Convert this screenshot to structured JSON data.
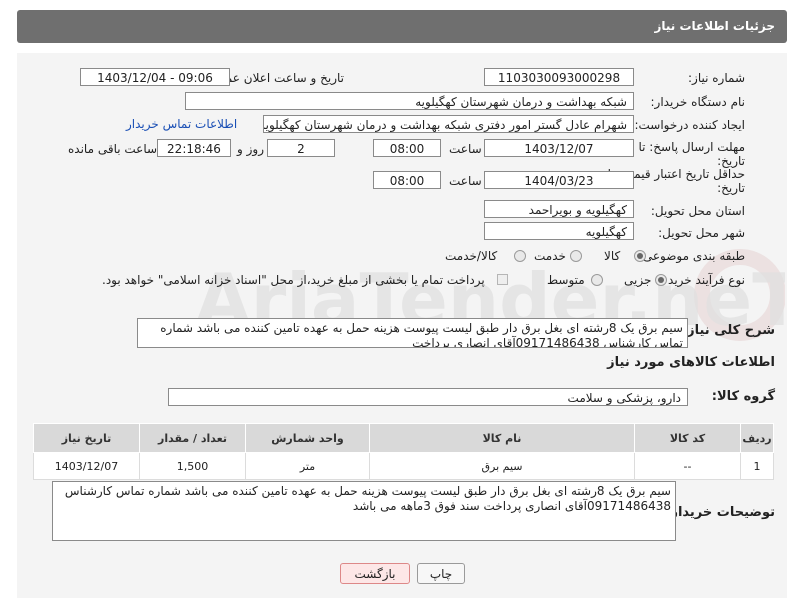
{
  "header": {
    "title": "جزئیات اطلاعات نیاز"
  },
  "form": {
    "need_number_label": "شماره نیاز:",
    "need_number": "1103030093000298",
    "announce_label": "تاریخ و ساعت اعلان عمومی:",
    "announce_value": "1403/12/04 - 09:06",
    "buyer_org_label": "نام دستگاه خریدار:",
    "buyer_org": "شبکه بهداشت و درمان شهرستان کهگیلویه",
    "creator_label": "ایجاد کننده درخواست:",
    "creator": "شهرام عادل گستر امور دفتری شبکه بهداشت و درمان شهرستان کهگیلویه",
    "buyer_contact_link": "اطلاعات تماس خریدار",
    "deadline_label_1": "مهلت ارسال پاسخ: تا",
    "deadline_label_2": "تاریخ:",
    "deadline_date": "1403/12/07",
    "time_label": "ساعت",
    "deadline_time": "08:00",
    "days_count": "2",
    "days_label": "روز و",
    "remaining_time": "22:18:46",
    "remaining_label": "ساعت باقی مانده",
    "validity_label_1": "حداقل تاریخ اعتبار قیمت: تا",
    "validity_label_2": "تاریخ:",
    "validity_date": "1404/03/23",
    "validity_time": "08:00",
    "province_label": "استان محل تحویل:",
    "province": "کهگیلویه و بویراحمد",
    "city_label": "شهر محل تحویل:",
    "city": "کهگیلویه",
    "category_label": "طبقه بندی موضوعی:",
    "category_options": [
      "کالا",
      "خدمت",
      "کالا/خدمت"
    ],
    "category_selected": "کالا",
    "process_label": "نوع فرآیند خرید :",
    "process_options": [
      "جزیی",
      "متوسط"
    ],
    "process_selected": "جزیی",
    "payment_note": "پرداخت تمام یا بخشی از مبلغ خرید،از محل \"اسناد خزانه اسلامی\" خواهد بود.",
    "summary_label": "شرح کلی نیاز:",
    "summary_text": "سیم برق یک 8رشته ای بغل برق دار طبق لیست پیوست هزینه حمل به عهده تامین کننده می باشد شماره تماس کارشناس 09171486438آقای انصاری پرداخت",
    "goods_info_title": "اطلاعات کالاهای مورد نیاز",
    "goods_group_label": "گروه کالا:",
    "goods_group": "دارو، پزشکی و سلامت"
  },
  "table": {
    "headers": [
      "ردیف",
      "کد کالا",
      "نام کالا",
      "واحد شمارش",
      "تعداد / مقدار",
      "تاریخ نیاز"
    ],
    "rows": [
      [
        "1",
        "--",
        "سیم برق",
        "متر",
        "1,500",
        "1403/12/07"
      ]
    ]
  },
  "buyer_desc_label": "توضیحات خریدار:",
  "buyer_desc": "سیم برق یک 8رشته ای بغل برق دار طبق لیست پیوست هزینه حمل به عهده تامین کننده می باشد شماره تماس کارشناس 09171486438آقای انصاری پرداخت سند فوق 3ماهه می باشد",
  "buttons": {
    "print": "چاپ",
    "back": "بازگشت"
  },
  "watermark_text": "AriaTender.neT"
}
